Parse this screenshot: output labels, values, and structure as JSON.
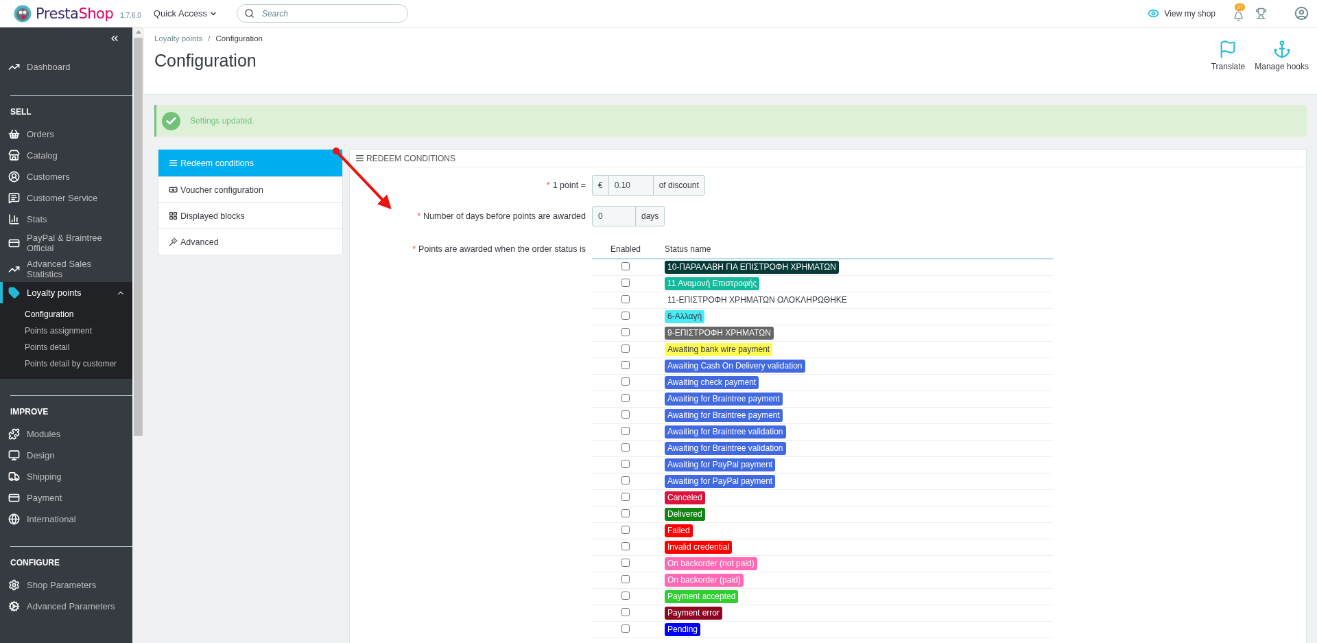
{
  "topbar": {
    "logo_parts": [
      "Presta",
      "Shop"
    ],
    "version": "1.7.6.0",
    "quick_access": "Quick Access",
    "search": {
      "placeholder": "Search"
    },
    "view_shop": "View my shop",
    "notifications": "37"
  },
  "sidebar": {
    "sections": [
      {
        "items": [
          {
            "label": "Dashboard",
            "selected": false,
            "expanded": false
          }
        ]
      },
      {
        "title": "SELL",
        "items": [
          {
            "label": "Orders",
            "selected": false,
            "expanded": false
          },
          {
            "label": "Catalog",
            "selected": false,
            "expanded": false
          },
          {
            "label": "Customers",
            "selected": false,
            "expanded": false
          },
          {
            "label": "Customer Service",
            "selected": false,
            "expanded": false
          },
          {
            "label": "Stats",
            "selected": false,
            "expanded": false
          },
          {
            "label": "PayPal & Braintree Official",
            "selected": false,
            "expanded": false
          },
          {
            "label": "Advanced Sales Statistics",
            "selected": false,
            "expanded": false
          },
          {
            "label": "Loyalty points",
            "selected": true,
            "expanded": true,
            "children": [
              {
                "label": "Configuration",
                "selected": true
              },
              {
                "label": "Points assignment",
                "selected": false
              },
              {
                "label": "Points detail",
                "selected": false
              },
              {
                "label": "Points detail by customer",
                "selected": false
              }
            ]
          }
        ]
      },
      {
        "title": "IMPROVE",
        "items": [
          {
            "label": "Modules",
            "selected": false,
            "expanded": false
          },
          {
            "label": "Design",
            "selected": false,
            "expanded": false
          },
          {
            "label": "Shipping",
            "selected": false,
            "expanded": false
          },
          {
            "label": "Payment",
            "selected": false,
            "expanded": false
          },
          {
            "label": "International",
            "selected": false,
            "expanded": false
          }
        ]
      },
      {
        "title": "CONFIGURE",
        "items": [
          {
            "label": "Shop Parameters",
            "selected": false,
            "expanded": false
          },
          {
            "label": "Advanced Parameters",
            "selected": false,
            "expanded": false
          }
        ]
      }
    ]
  },
  "breadcrumb": [
    "Loyalty points",
    "Configuration"
  ],
  "breadcrumb_separator": "/",
  "page_title": "Configuration",
  "toolbar": [
    {
      "label": "Translate"
    },
    {
      "label": "Manage hooks"
    }
  ],
  "alert": "Settings updated.",
  "tabs": [
    {
      "label": "Redeem conditions",
      "selected": true
    },
    {
      "label": "Voucher configuration",
      "selected": false
    },
    {
      "label": "Displayed blocks",
      "selected": false
    },
    {
      "label": "Advanced",
      "selected": false
    }
  ],
  "panel": {
    "heading": "REDEEM CONDITIONS",
    "fields": [
      {
        "label": "1 point =",
        "required_mark": "*",
        "prefix": "€",
        "value": "0.10",
        "suffix": "of discount"
      },
      {
        "label": "Number of days before points are awarded",
        "required_mark": "*",
        "value": "0",
        "suffix": "days"
      }
    ],
    "statuses": {
      "label": "Points are awarded when the order status is",
      "required_mark": "*",
      "columns": [
        "Enabled",
        "Status name"
      ],
      "rows": [
        {
          "name": "10-ΠΑΡΑΛΑΒΗ ΓΙΑ ΕΠΙΣΤΡΟΦΗ ΧΡΗΜΑΤΩΝ",
          "color": "#073b38",
          "checked": false
        },
        {
          "name": "11 Αναμονή Επιστροφής",
          "color": "#13b99a",
          "checked": false
        },
        {
          "name": "11-ΕΠΙΣΤΡΟΦΗ ΧΡΗΜΑΤΩΝ ΟΛΟΚΛΗΡΩΘΗΚΕ",
          "checked": false
        },
        {
          "name": "6-Αλλαγή",
          "color": "#4aeaf5",
          "checked": false
        },
        {
          "name": "9-ΕΠΙΣΤΡΟΦΗ ΧΡΗΜΑΤΩΝ",
          "color": "#666666",
          "checked": false
        },
        {
          "name": "Awaiting bank wire payment",
          "color": "#fffb55",
          "checked": false
        },
        {
          "name": "Awaiting Cash On Delivery validation",
          "color": "#4169e1",
          "checked": false
        },
        {
          "name": "Awaiting check payment",
          "color": "#4169e1",
          "checked": false
        },
        {
          "name": "Awaiting for Braintree payment",
          "color": "#4169e1",
          "checked": false
        },
        {
          "name": "Awaiting for Braintree payment",
          "color": "#4169e1",
          "checked": false
        },
        {
          "name": "Awaiting for Braintree validation",
          "color": "#4169e1",
          "checked": false
        },
        {
          "name": "Awaiting for Braintree validation",
          "color": "#4169e1",
          "checked": false
        },
        {
          "name": "Awaiting for PayPal payment",
          "color": "#4169e1",
          "checked": false
        },
        {
          "name": "Awaiting for PayPal payment",
          "color": "#4169e1",
          "checked": false
        },
        {
          "name": "Canceled",
          "color": "#dc143c",
          "checked": false
        },
        {
          "name": "Delivered",
          "color": "#108510",
          "checked": false
        },
        {
          "name": "Failed",
          "color": "#ff0000",
          "checked": false
        },
        {
          "name": "Invalid credential",
          "color": "#ff0000",
          "checked": false
        },
        {
          "name": "On backorder (not paid)",
          "color": "#ff69b4",
          "checked": false
        },
        {
          "name": "On backorder (paid)",
          "color": "#ff69b4",
          "checked": false
        },
        {
          "name": "Payment accepted",
          "color": "#32cd32",
          "checked": false
        },
        {
          "name": "Payment error",
          "color": "#8f0621",
          "checked": false
        },
        {
          "name": "Pending",
          "color": "#0000ff",
          "checked": false
        }
      ]
    }
  }
}
